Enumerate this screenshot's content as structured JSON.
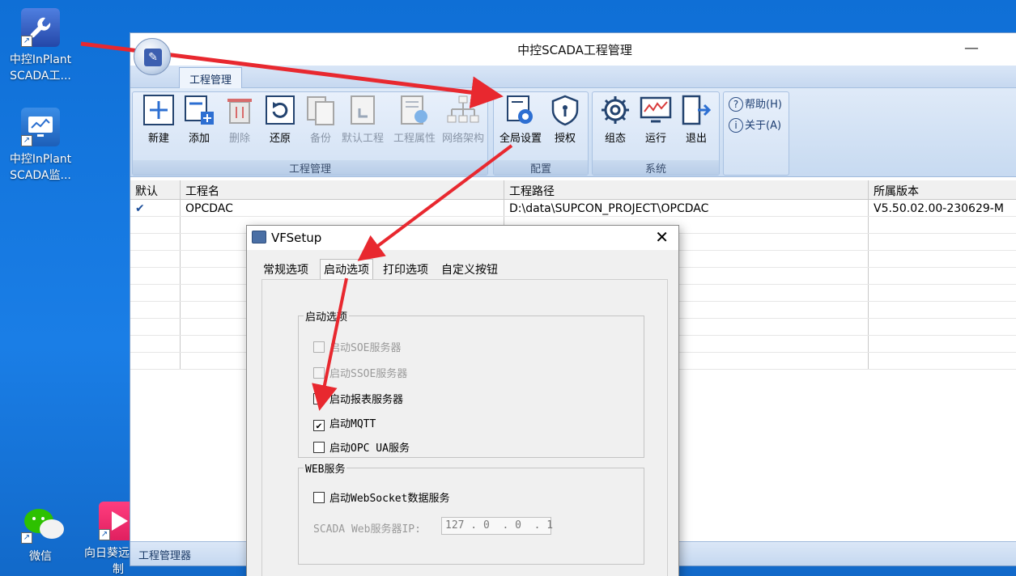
{
  "desktop": {
    "icons": [
      {
        "label": "中控InPlant SCADA工..."
      },
      {
        "label": "中控InPlant SCADA监..."
      },
      {
        "label": "微信"
      },
      {
        "label": "向日葵远程控制"
      }
    ]
  },
  "window": {
    "title": "中控SCADA工程管理",
    "tab": "工程管理",
    "groups": {
      "project": {
        "label": "工程管理",
        "buttons": [
          "新建",
          "添加",
          "删除",
          "还原",
          "备份",
          "默认工程",
          "工程属性",
          "网络架构"
        ]
      },
      "config": {
        "label": "配置",
        "buttons": [
          "全局设置",
          "授权"
        ]
      },
      "system": {
        "label": "系统",
        "buttons": [
          "组态",
          "运行",
          "退出"
        ]
      },
      "help": {
        "help": "帮助(H)",
        "about": "关于(A)"
      }
    },
    "table": {
      "columns": [
        "默认",
        "工程名",
        "工程路径",
        "所属版本"
      ],
      "rows": [
        {
          "default": "✔",
          "name": "OPCDAC",
          "path": "D:\\data\\SUPCON_PROJECT\\OPCDAC",
          "version": "V5.50.02.00-230629-M"
        }
      ]
    },
    "status": "工程管理器"
  },
  "dialog": {
    "title": "VFSetup",
    "tabs": [
      "常规选项",
      "启动选项",
      "打印选项",
      "自定义按钮"
    ],
    "active_tab": "启动选项",
    "startup_group": {
      "legend": "启动选项",
      "options": [
        {
          "label": "启动SOE服务器",
          "checked": false,
          "enabled": false
        },
        {
          "label": "启动SSOE服务器",
          "checked": false,
          "enabled": false
        },
        {
          "label": "启动报表服务器",
          "checked": false,
          "enabled": true
        },
        {
          "label": "启动MQTT",
          "checked": true,
          "enabled": true
        },
        {
          "label": "启动OPC UA服务",
          "checked": false,
          "enabled": true
        }
      ]
    },
    "web_group": {
      "legend": "WEB服务",
      "websocket_label": "启动WebSocket数据服务",
      "ip_label": "SCADA Web服务器IP:",
      "ip_value": "127 . 0  . 0  . 1"
    }
  },
  "colors": {
    "desktop": "#1a7ee6",
    "ribbon": "#d2e1f4",
    "arrow": "#e8282f"
  }
}
